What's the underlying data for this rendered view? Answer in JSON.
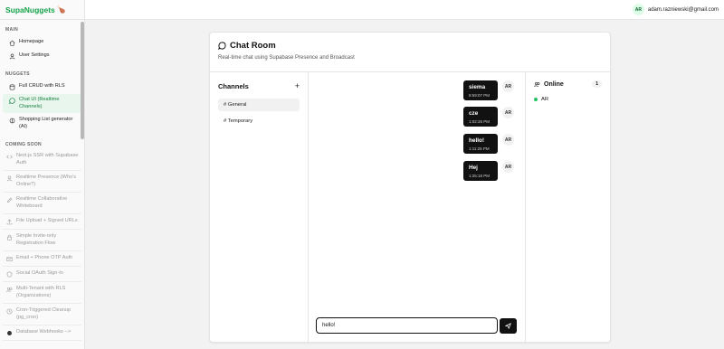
{
  "app": {
    "name": "SupaNuggets",
    "logo_glyph": "🍗",
    "accent": "#16a34a"
  },
  "user": {
    "initials": "AR",
    "email": "adam.razniewski@gmail.com"
  },
  "sidebar": {
    "sections": {
      "main": "MAIN",
      "nuggets": "NUGGETS",
      "coming_soon": "COMING SOON"
    },
    "main_items": [
      {
        "label": "Homepage",
        "icon": "home-icon"
      },
      {
        "label": "User Settings",
        "icon": "user-icon"
      }
    ],
    "nugget_items": [
      {
        "label": "Full CRUD with RLS",
        "icon": "database-icon"
      },
      {
        "label": "Chat UI (Realtime Channels)",
        "icon": "chat-icon",
        "active": true
      },
      {
        "label": "Shopping List generator (AI)",
        "icon": "brain-icon"
      }
    ],
    "coming_items": [
      {
        "label": "Next.js SSR with Supabase Auth",
        "icon": "code-icon"
      },
      {
        "label": "Realtime Presence (Who's Online?)",
        "icon": "user-icon"
      },
      {
        "label": "Realtime Collaborative Whiteboard",
        "icon": "pen-icon"
      },
      {
        "label": "File Upload + Signed URLs",
        "icon": "upload-icon"
      },
      {
        "label": "Simple Invite-only Registration Flow",
        "icon": "lock-icon"
      },
      {
        "label": "Email + Phone OTP Auth",
        "icon": "mail-icon"
      },
      {
        "label": "Social OAuth Sign-In",
        "icon": "shield-icon"
      },
      {
        "label": "Multi-Tenant with RLS (Organizations)",
        "icon": "users-icon"
      },
      {
        "label": "Cron-Triggered Cleanup (pg_cron)",
        "icon": "clock-icon"
      },
      {
        "label": "Database Webhooks -->",
        "icon": "webhook-icon"
      }
    ]
  },
  "chat": {
    "title": "Chat Room",
    "subtitle": "Real-time chat using Supabase Presence and Broadcast",
    "channels_title": "Channels",
    "add_glyph": "+",
    "channels": [
      {
        "label": "# General",
        "active": true
      },
      {
        "label": "# Temporary",
        "active": false
      }
    ],
    "messages": [
      {
        "text": "siema",
        "time": "8:59:07 PM",
        "initials": "AR"
      },
      {
        "text": "cze",
        "time": "1:02:26 PM",
        "initials": "AR"
      },
      {
        "text": "hello!",
        "time": "1:11:25 PM",
        "initials": "AR"
      },
      {
        "text": "Hej",
        "time": "1:25:18 PM",
        "initials": "AR"
      }
    ],
    "composer_value": "hello!",
    "online_title": "Online",
    "online_count": "1",
    "online_users": [
      {
        "name": "AR",
        "status_color": "#22c55e"
      }
    ]
  }
}
